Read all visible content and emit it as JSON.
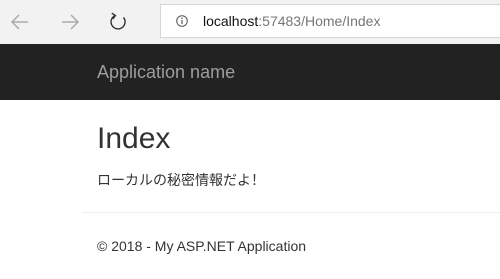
{
  "browser": {
    "back_icon": "back-arrow-icon",
    "forward_icon": "forward-arrow-icon",
    "refresh_icon": "refresh-icon",
    "info_icon": "info-icon",
    "url_host": "localhost",
    "url_rest": ":57483/Home/Index"
  },
  "navbar": {
    "brand": "Application name",
    "background": "#222222",
    "brand_color": "#9d9d9d"
  },
  "main": {
    "title": "Index",
    "message": "ローカルの秘密情報だよ！"
  },
  "footer": {
    "text": "© 2018 - My ASP.NET Application"
  }
}
